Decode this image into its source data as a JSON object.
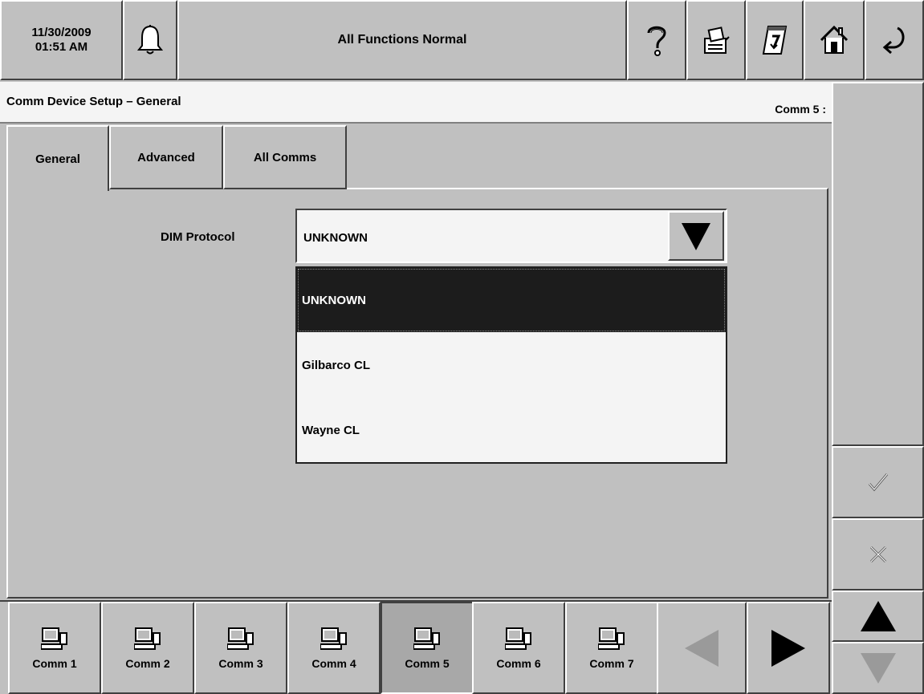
{
  "header": {
    "date": "11/30/2009",
    "time": "01:51 AM",
    "status": "All Functions Normal"
  },
  "icons": [
    "bell-icon",
    "help-icon",
    "printer-icon",
    "report-icon",
    "home-icon",
    "back-arrow-icon",
    "check-icon",
    "close-icon",
    "computer-icon",
    "triangle-left-icon",
    "triangle-right-icon",
    "triangle-up-icon",
    "triangle-down-icon"
  ],
  "page": {
    "title": "Comm Device Setup – General",
    "comm_label": "Comm 5 :"
  },
  "tabs": [
    "General",
    "Advanced",
    "All Comms"
  ],
  "form": {
    "dim_protocol_label": "DIM Protocol",
    "dim_protocol_value": "UNKNOWN",
    "options": [
      "UNKNOWN",
      "Gilbarco CL",
      "Wayne CL"
    ],
    "selected_index": 0
  },
  "comms": [
    "Comm 1",
    "Comm 2",
    "Comm 3",
    "Comm 4",
    "Comm 5",
    "Comm 6",
    "Comm 7"
  ],
  "active_comm_index": 4,
  "colors": {
    "background": "#c0c0c0",
    "highlight": "#1c1c1c",
    "field": "#f4f4f4",
    "disabled": "#9a9a9a"
  }
}
